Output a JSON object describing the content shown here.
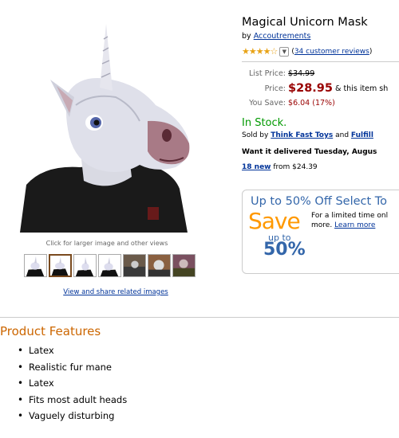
{
  "product": {
    "title": "Magical Unicorn Mask",
    "by_label": "by",
    "brand": "Accoutrements",
    "stars_glyphs": "★★★★☆",
    "reviews_link": "34 customer reviews"
  },
  "pricing": {
    "list_label": "List Price:",
    "list_price": "$34.99",
    "price_label": "Price:",
    "price": "$28.95",
    "price_note": "& this item sh",
    "save_label": "You Save:",
    "save_amount": "$6.04 (17%)"
  },
  "availability": {
    "status": "In Stock.",
    "sold_by_label": "Sold by",
    "seller": "Think Fast Toys",
    "and_label": "and",
    "fulfilled": "Fulfill",
    "delivery": "Want it delivered Tuesday, Augus",
    "new_count": "18 new",
    "new_from": "from $24.39"
  },
  "image_panel": {
    "caption": "Click for larger image and other views",
    "related_link": "View and share related images",
    "thumbnail_count": 7
  },
  "promo": {
    "title": "Up to 50% Off Select To",
    "save": "Save",
    "up_to": "up to",
    "percent": "50%",
    "text": "For a limited time onl",
    "more": "more.",
    "learn_more": "Learn more"
  },
  "features": {
    "heading": "Product Features",
    "items": [
      "Latex",
      "Realistic fur mane",
      "Latex",
      "Fits most adult heads",
      "Vaguely disturbing"
    ]
  },
  "colors": {
    "link": "#003399",
    "price": "#990000",
    "in_stock": "#009900",
    "feature_heading": "#cc6600",
    "promo_orange": "#ff9900",
    "promo_blue": "#3366aa"
  }
}
